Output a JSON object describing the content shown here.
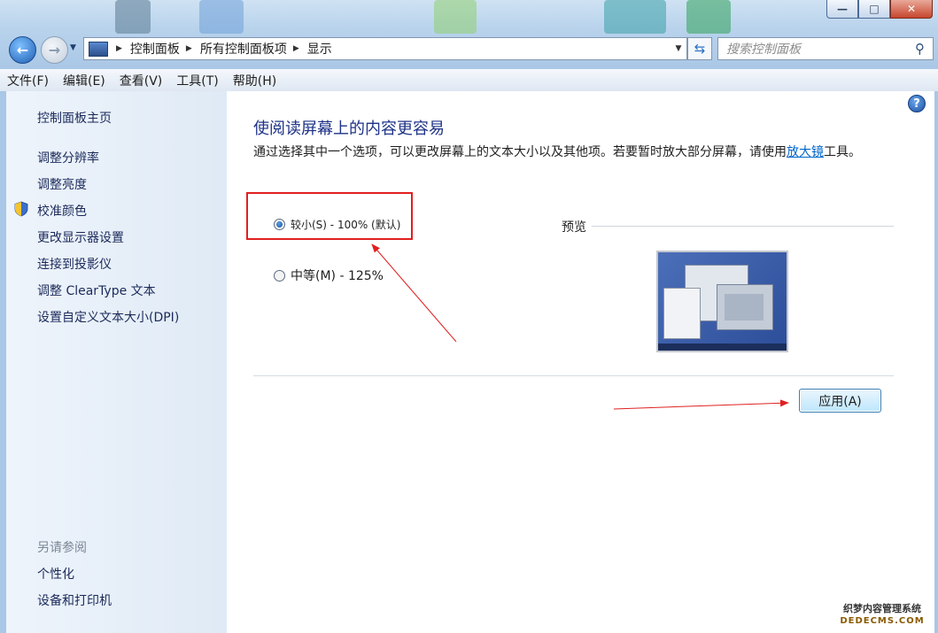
{
  "titlebar": {
    "buttons": [
      "minimize-icon",
      "maximize-icon",
      "close-icon"
    ]
  },
  "nav": {
    "back": "back-arrow-icon",
    "forward": "forward-arrow-icon"
  },
  "address": {
    "crumbs": [
      "控制面板",
      "所有控制面板项",
      "显示"
    ],
    "search_placeholder": "搜索控制面板"
  },
  "menubar": [
    "文件(F)",
    "编辑(E)",
    "查看(V)",
    "工具(T)",
    "帮助(H)"
  ],
  "sidebar": {
    "home": "控制面板主页",
    "items": [
      "调整分辨率",
      "调整亮度",
      "校准颜色",
      "更改显示器设置",
      "连接到投影仪",
      "调整 ClearType 文本",
      "设置自定义文本大小(DPI)"
    ],
    "see_also_title": "另请参阅",
    "see_also": [
      "个性化",
      "设备和打印机"
    ]
  },
  "main": {
    "title": "使阅读屏幕上的内容更容易",
    "desc_before": "通过选择其中一个选项，可以更改屏幕上的文本大小以及其他项。若要暂时放大部分屏幕，请使用",
    "desc_link": "放大镜",
    "desc_after": "工具。",
    "options": [
      {
        "label": "较小(S) - 100% (默认)",
        "selected": true
      },
      {
        "label": "中等(M) - 125%",
        "selected": false
      }
    ],
    "preview_label": "预览",
    "apply_label": "应用(A)"
  },
  "watermark": {
    "line1": "织梦内容管理系统",
    "line2": "DEDECMS.COM"
  },
  "colors": {
    "annotation": "#e02020",
    "link": "#0066cc",
    "title": "#1e3287"
  }
}
